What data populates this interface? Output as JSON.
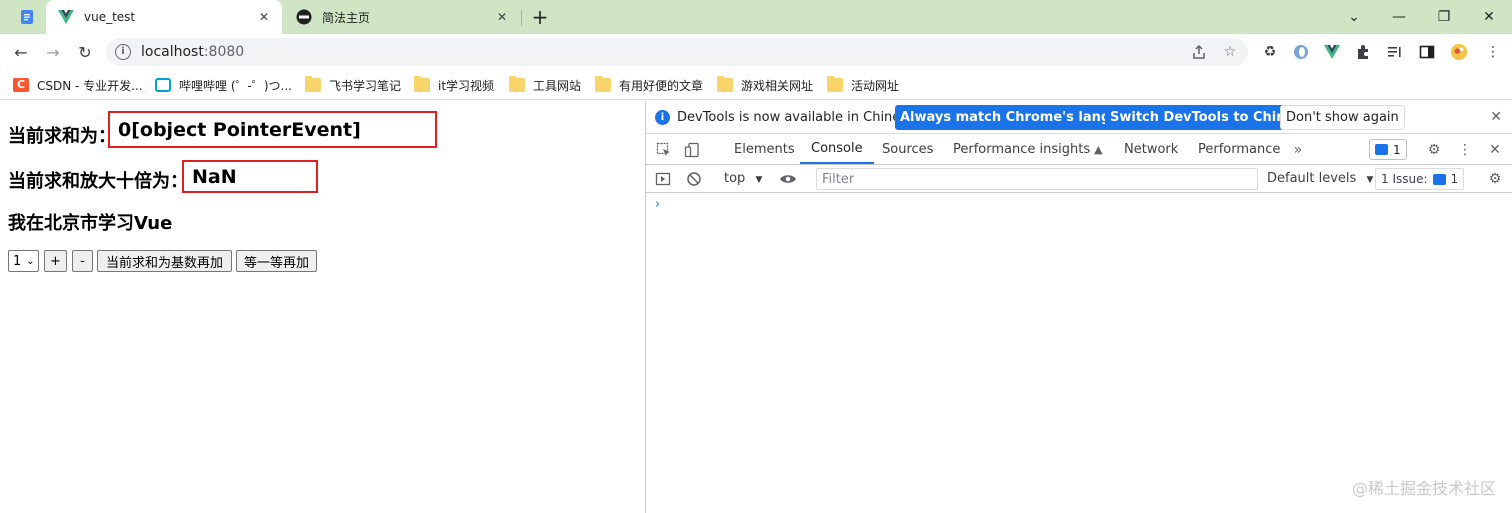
{
  "tabs": {
    "pinned_icon": "docs-icon",
    "active": {
      "title": "vue_test",
      "icon": "vue-icon"
    },
    "inactive": {
      "title": "简法主页",
      "icon": "jianfa-icon"
    },
    "new_tab": "+"
  },
  "window_controls": {
    "minimize": "—",
    "maximize": "❐",
    "close": "✕",
    "tab_search": "⌄"
  },
  "toolbar": {
    "back": "←",
    "forward": "→",
    "reload": "↻",
    "url_host": "localhost",
    "url_port": ":8080",
    "info_icon": "i"
  },
  "bookmarks": [
    {
      "label": "CSDN - 专业开发...",
      "icon": "csdn-icon"
    },
    {
      "label": "哔哩哔哩 (゜-゜)つ...",
      "icon": "bilibili-icon"
    },
    {
      "label": "飞书学习笔记",
      "icon": "folder-icon"
    },
    {
      "label": "it学习视频",
      "icon": "folder-icon"
    },
    {
      "label": "工具网站",
      "icon": "folder-icon"
    },
    {
      "label": "有用好便的文章",
      "icon": "folder-icon"
    },
    {
      "label": "游戏相关网址",
      "icon": "folder-icon"
    },
    {
      "label": "活动网址",
      "icon": "folder-icon"
    }
  ],
  "page": {
    "sum_label": "当前求和为：",
    "sum_value": "0[object PointerEvent]",
    "magnified_label": "当前求和放大十倍为：",
    "magnified_value": "NaN",
    "study_text": "我在北京市学习Vue",
    "select_value": "1",
    "plus_button": "+",
    "minus_button": "-",
    "odd_add_button": "当前求和为基数再加",
    "wait_add_button": "等一等再加"
  },
  "devtools": {
    "infobar": {
      "message": "DevTools is now available in Chinese!",
      "match_button": "Always match Chrome's language",
      "switch_button": "Switch DevTools to Chinese",
      "dismiss_button": "Don't show again"
    },
    "tabs": [
      "Elements",
      "Console",
      "Sources",
      "Performance insights",
      "Network",
      "Performance"
    ],
    "active_tab": "Console",
    "message_count": "1",
    "console_bar": {
      "context": "top",
      "filter_placeholder": "Filter",
      "levels": "Default levels",
      "issue_label": "1 Issue:",
      "issue_count": "1"
    },
    "prompt_symbol": "›"
  },
  "watermark": "@稀土掘金技术社区",
  "colors": {
    "tab_strip": "#cfe5c4",
    "accent": "#1a73e8",
    "highlight_border": "#e02020"
  }
}
